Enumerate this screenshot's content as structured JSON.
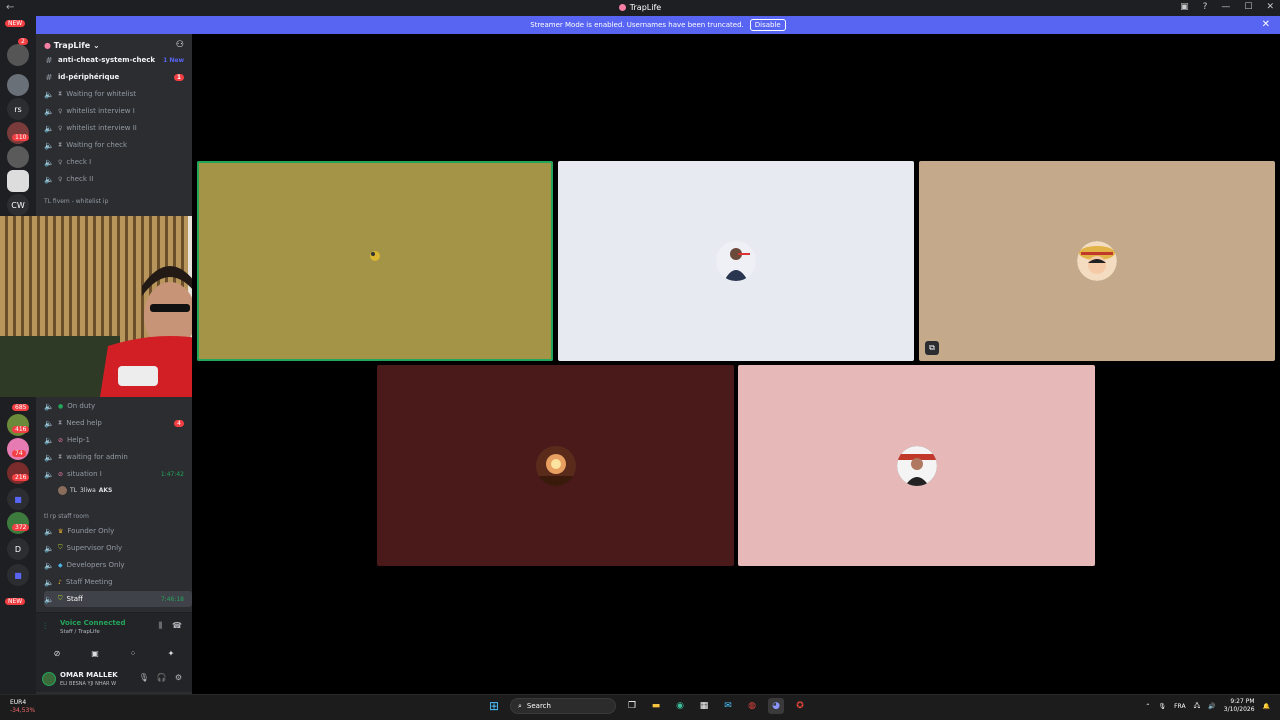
{
  "window": {
    "title": "TrapLife",
    "controls": [
      "—",
      "☐",
      "✕"
    ]
  },
  "banner": {
    "text": "Streamer Mode is enabled. Usernames have been truncated.",
    "button": "Disable"
  },
  "guildbar": {
    "top_badge": "NEW",
    "badges": [
      "2",
      "1",
      "110",
      "7",
      "685",
      "416",
      "74",
      "216",
      "372"
    ],
    "labels": [
      "rs",
      "CW",
      "D"
    ],
    "bottom_badge": "NEW"
  },
  "server": {
    "name": "TrapLife"
  },
  "channels_top": [
    {
      "label": "anti-cheat-system-check",
      "new": "1 New"
    },
    {
      "label": "id-périphérique",
      "badge": "1"
    },
    {
      "label": "Waiting for whitelist"
    },
    {
      "label": "whitelist interview I"
    },
    {
      "label": "whitelist interview II"
    },
    {
      "label": "Waiting for check"
    },
    {
      "label": "check I"
    },
    {
      "label": "check II"
    }
  ],
  "category_whitelist": "TL fivem - whitelist ip",
  "channels_mid": [
    {
      "label": "On duty"
    },
    {
      "label": "Need help",
      "badge": "4"
    },
    {
      "label": "Help-1"
    },
    {
      "label": "waiting for admin"
    },
    {
      "label": "situation I",
      "time": "1:47:42"
    }
  ],
  "voice_member": {
    "prefix": "TL",
    "name": "3liwa",
    "tag": "AKS"
  },
  "category_staff": "tl rp staff room",
  "channels_staff": [
    {
      "label": "Founder Only"
    },
    {
      "label": "Supervisor Only"
    },
    {
      "label": "Developers Only"
    },
    {
      "label": "Staff Meeting"
    },
    {
      "label": "Staff",
      "time": "7:46:18"
    }
  ],
  "voice": {
    "status": "Voice Connected",
    "location": "Staff / TrapLife"
  },
  "user": {
    "name": "OMAR MALLEK",
    "status": "ELI BESNA YJI NHAR W"
  },
  "tiles": [
    {
      "name": "tile-1",
      "bg": "#a39448",
      "speaking": true
    },
    {
      "name": "tile-2",
      "bg": "#e7eaf1",
      "speaking": false
    },
    {
      "name": "tile-3",
      "bg": "#c4a98a",
      "speaking": false,
      "streaming": true
    },
    {
      "name": "tile-4",
      "bg": "#4a1a1a",
      "speaking": false
    },
    {
      "name": "tile-5",
      "bg": "#e6b8b8",
      "speaking": false
    }
  ],
  "taskbar": {
    "weather_temp": "EUR4",
    "weather_change": "-34,53%",
    "search": "Search",
    "lang": "FRA",
    "time": "9:27 PM",
    "date": "3/10/2026"
  }
}
